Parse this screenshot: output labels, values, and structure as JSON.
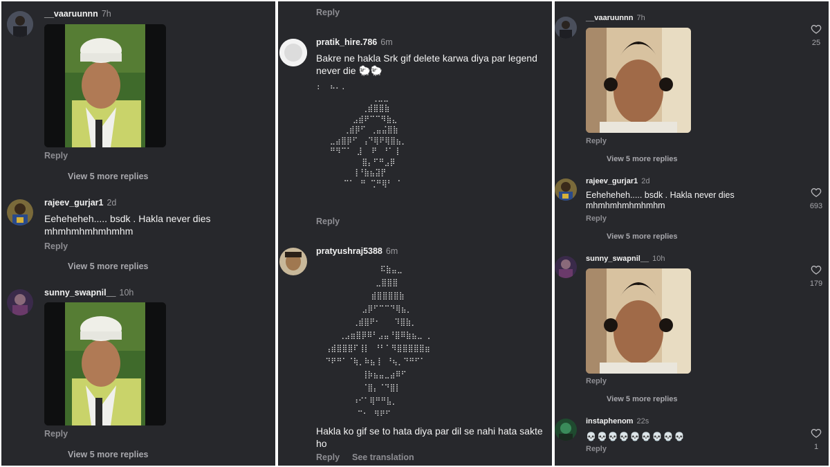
{
  "reply_label": "Reply",
  "see_translation": "See translation",
  "panel1": {
    "c1": {
      "user": "__vaaruunnn",
      "time": "7h",
      "more": "View 5 more replies"
    },
    "c2": {
      "user": "rajeev_gurjar1",
      "time": "2d",
      "text": "Eeheheheh..... bsdk . Hakla never dies mhmhmhmhmhmhm",
      "more": "View 5 more replies"
    },
    "c3": {
      "user": "sunny_swapnil__",
      "time": "10h",
      "more": "View 5 more replies"
    }
  },
  "panel2": {
    "c1": {
      "user": "pratik_hire.786",
      "time": "6m",
      "text": "Bakre ne hakla Srk gif delete karwa diya par legend never die 🐑🐑"
    },
    "c2": {
      "user": "pratyushraj5388",
      "time": "6m",
      "text": "Hakla ko gif se to hata diya par dil se nahi hata sakte ho"
    },
    "braille1": [
      ":  ⠦⠄.",
      "           ⠀⢀⣀⣀",
      "          ⢀⣾⣿⣿⣷",
      "        ⣠⣾⠟⠉⠉⠻⣷⣄",
      "      ⢀⣾⡿⠋ ⢀⣤⣬⣿⣷",
      "   ⣀⣴⣿⡿⠋ ⢠⠙⢿⠟⢿⣿⣦⡀",
      "   ⠛⠻⠉⠁ ⣸  ⠟⠀⠘⠁⢸",
      "          ⣿⡄⠋⠛⣠⡿",
      "        ⢸⠘⣷⣦⣽⡟",
      "      ⠉⠁⠀⠛ ⢉⠛⢿⠃ ⠁"
    ],
    "braille2": [
      "              ⠯⣷⣤⣀",
      "             ⣀⣿⣿⣿",
      "            ⣾⣿⣿⣿⣿⣷",
      "          ⣠⡿⠋⠉⠉⠙⢿⣦⡀",
      "        ⢀⣾⣿⠟⠂   ⠹⣿⣷⡀",
      "     ⢀⣠⣶⣿⡿⠿⠃⣠⣤⠘⣿⠿⣷⣦⣀ ⡀",
      "  ⢠⣾⣿⣿⣿⠏⢸⡇ ⠘⠃⠁⠻⣿⣿⣿⣿⣿⣶",
      "  ⠙⠟⠛⠁⠈⢷⡀⠷⣦⢸⠀⠘⢦⡀⠙⠛⠋⠁",
      "          ⢸⡷⣦⣤⣀⣴⠿⠋",
      "          ⠈⣿⡄⠈⠙⣿⡇",
      "        ⠰⠊⠁⢿⠛⠛⣧⡀",
      "         ⠉⠂⠀⠻⠟⠋"
    ]
  },
  "panel3": {
    "c1": {
      "user": "__vaaruunnn",
      "time": "7h",
      "likes": "25",
      "more": "View 5 more replies"
    },
    "c2": {
      "user": "rajeev_gurjar1",
      "time": "2d",
      "text": "Eeheheheh..... bsdk . Hakla never dies mhmhmhmhmhmhm",
      "likes": "693",
      "more": "View 5 more replies"
    },
    "c3": {
      "user": "sunny_swapnil__",
      "time": "10h",
      "likes": "179",
      "more": "View 5 more replies"
    },
    "c4": {
      "user": "instaphenom",
      "time": "22s",
      "text": "💀💀💀💀💀💀💀💀💀",
      "likes": "1"
    }
  }
}
